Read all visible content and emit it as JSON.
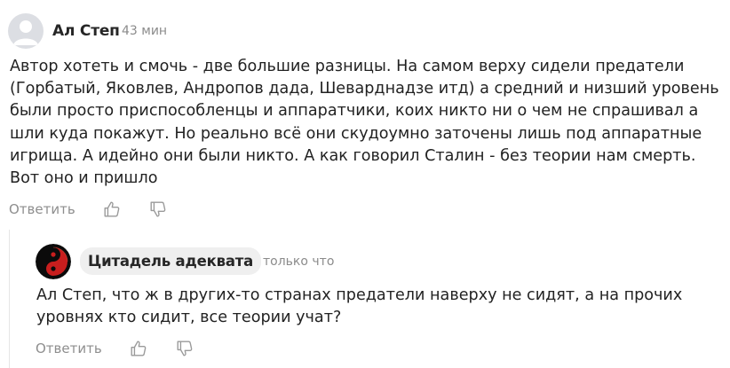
{
  "comment": {
    "author": "Ал Степ",
    "time": "43 мин",
    "text": "Автор хотеть и смочь - две большие разницы. На самом верху сидели предатели (Горбатый, Яковлев, Андропов дада, Шеварднадзе итд) а средний и низший уровень были просто приспособленцы и аппаратчики, коих никто ни о чем не спрашивал а шли куда покажут. Но реально всё они скудоумно заточены лишь под аппаратные игрища. А идейно они были никто. А как говорил Сталин - без теории нам смерть. Вот оно и пришло",
    "reply_label": "Ответить",
    "icons": {
      "avatar": "default-user-avatar-icon",
      "like": "thumbs-up-icon",
      "dislike": "thumbs-down-icon"
    }
  },
  "reply": {
    "author": "Цитадель адеквата",
    "time": "только что",
    "text": "Ал Степ, что ж в других-то странах предатели наверху не сидят, а на прочих уровнях кто сидит, все теории учат?",
    "reply_label": "Ответить",
    "icons": {
      "avatar": "yin-yang-avatar-icon",
      "like": "thumbs-up-icon",
      "dislike": "thumbs-down-icon"
    }
  },
  "colors": {
    "text": "#222222",
    "muted": "#8b8b8b",
    "chip_bg": "#efefef",
    "avatar_bg": "#dcdee3",
    "yin_red": "#c81e1e"
  }
}
